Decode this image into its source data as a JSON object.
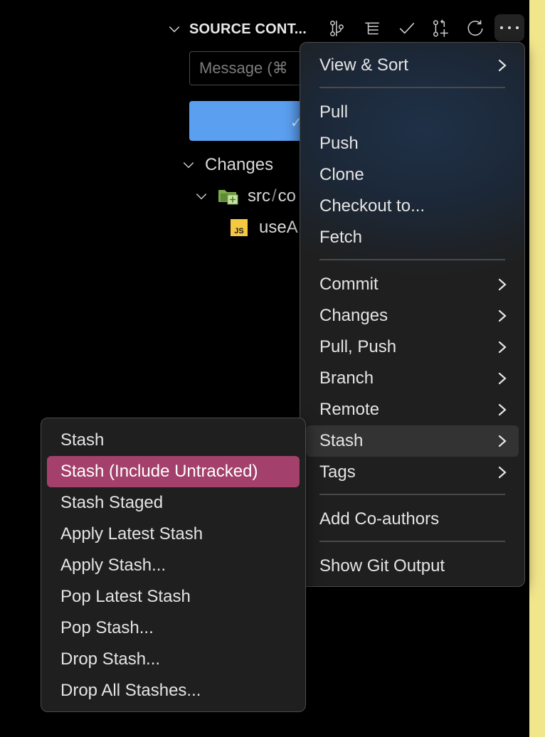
{
  "header": {
    "title": "SOURCE CONT...",
    "toolbar_icons": [
      "graph-icon",
      "view-list-icon",
      "commit-check-icon",
      "create-pull-request-icon",
      "refresh-icon",
      "more-actions-icon"
    ]
  },
  "commit": {
    "message_placeholder": "Message (⌘",
    "button_label": "✓"
  },
  "tree": {
    "group_label": "Changes",
    "folder_label": "src",
    "folder_path_rest": "co",
    "file_label": "useA",
    "file_icon_text": "JS"
  },
  "main_menu": {
    "items": [
      {
        "label": "View & Sort",
        "submenu": true
      },
      {
        "label": "Pull",
        "submenu": false
      },
      {
        "label": "Push",
        "submenu": false
      },
      {
        "label": "Clone",
        "submenu": false
      },
      {
        "label": "Checkout to...",
        "submenu": false
      },
      {
        "label": "Fetch",
        "submenu": false
      },
      {
        "label": "Commit",
        "submenu": true
      },
      {
        "label": "Changes",
        "submenu": true
      },
      {
        "label": "Pull, Push",
        "submenu": true
      },
      {
        "label": "Branch",
        "submenu": true
      },
      {
        "label": "Remote",
        "submenu": true
      },
      {
        "label": "Stash",
        "submenu": true,
        "state": "open"
      },
      {
        "label": "Tags",
        "submenu": true
      },
      {
        "label": "Add Co-authors",
        "submenu": false
      },
      {
        "label": "Show Git Output",
        "submenu": false
      }
    ]
  },
  "stash_menu": {
    "items": [
      {
        "label": "Stash"
      },
      {
        "label": "Stash (Include Untracked)",
        "state": "highlighted"
      },
      {
        "label": "Stash Staged"
      },
      {
        "label": "Apply Latest Stash"
      },
      {
        "label": "Apply Stash..."
      },
      {
        "label": "Pop Latest Stash"
      },
      {
        "label": "Pop Stash..."
      },
      {
        "label": "Drop Stash..."
      },
      {
        "label": "Drop All Stashes..."
      }
    ]
  },
  "colors": {
    "highlight": "#a3406b",
    "commit_button": "#5b9ff0",
    "side_strip": "#f2e68c"
  }
}
